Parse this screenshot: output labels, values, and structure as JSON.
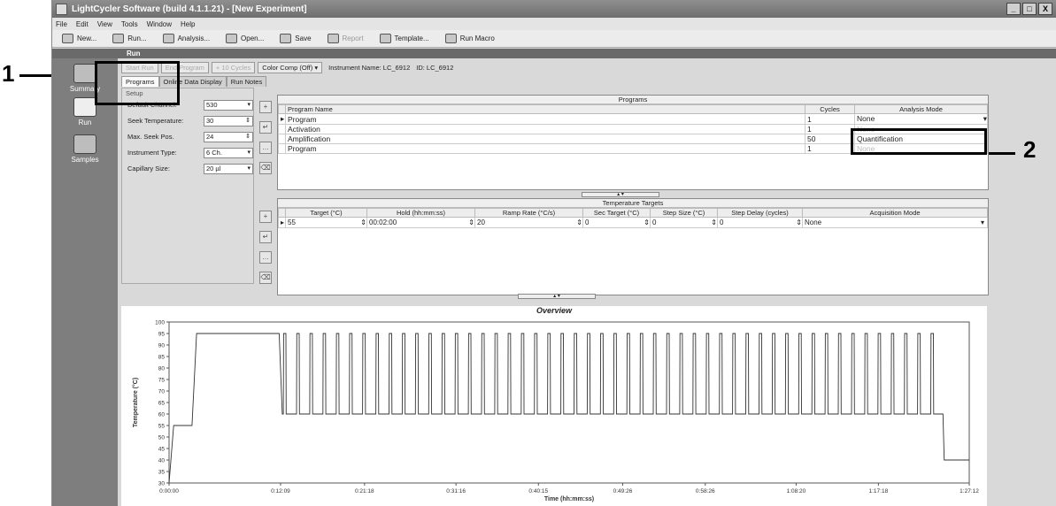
{
  "window": {
    "title": "LightCycler Software (build 4.1.1.21) - [New Experiment]",
    "controls": [
      "_",
      "□",
      "X"
    ]
  },
  "menu": [
    "File",
    "Edit",
    "View",
    "Tools",
    "Window",
    "Help"
  ],
  "toolbar": {
    "new": "New...",
    "run": "Run...",
    "analysis": "Analysis...",
    "open": "Open...",
    "save": "Save",
    "report": "Report",
    "template": "Template...",
    "run_macro": "Run Macro"
  },
  "run_bar": "Run",
  "nav": {
    "summary": "Summary",
    "run": "Run",
    "samples": "Samples"
  },
  "controls": {
    "start_run": "Start Run",
    "end_program": "End Program",
    "plus_cycles": "+ 10 Cycles",
    "color_comp": "Color Comp (Off)",
    "instrument_name": "Instrument Name: LC_6912",
    "instrument_id": "ID: LC_6912"
  },
  "tabs": [
    "Programs",
    "Online Data Display",
    "Run Notes"
  ],
  "setup": {
    "header": "Setup",
    "fields": [
      {
        "label": "Default Channel:",
        "value": "530"
      },
      {
        "label": "Seek Temperature:",
        "value": "30"
      },
      {
        "label": "Max. Seek Pos.",
        "value": "24"
      },
      {
        "label": "Instrument Type:",
        "value": "6 Ch."
      },
      {
        "label": "Capillary Size:",
        "value": "20 µl"
      }
    ]
  },
  "programs": {
    "title": "Programs",
    "columns": [
      "Program Name",
      "Cycles",
      "Analysis Mode"
    ],
    "rows": [
      {
        "name": "Program",
        "cycles": "1",
        "mode": "None"
      },
      {
        "name": "Activation",
        "cycles": "1",
        "mode": "None"
      },
      {
        "name": "Amplification",
        "cycles": "50",
        "mode": "Quantification"
      },
      {
        "name": "Program",
        "cycles": "1",
        "mode": "None"
      }
    ]
  },
  "temperature_targets": {
    "title": "Temperature Targets",
    "columns": [
      "Target (°C)",
      "Hold (hh:mm:ss)",
      "Ramp Rate (°C/s)",
      "Sec Target (°C)",
      "Step Size (°C)",
      "Step Delay (cycles)",
      "Acquisition Mode"
    ],
    "rows": [
      {
        "target": "55",
        "hold": "00:02:00",
        "ramp": "20",
        "sec_target": "0",
        "step_size": "0",
        "step_delay": "0",
        "acquisition": "None"
      }
    ]
  },
  "overview": {
    "title": "Overview"
  },
  "callouts": {
    "one": "1",
    "two": "2"
  },
  "chart_data": {
    "type": "line",
    "title": "Overview",
    "xlabel": "Time (hh:mm:ss)",
    "ylabel": "Temperature (°C)",
    "ylim": [
      30,
      100
    ],
    "yticks": [
      30,
      35,
      40,
      45,
      50,
      55,
      60,
      65,
      70,
      75,
      80,
      85,
      90,
      95,
      100
    ],
    "xticks": [
      "0:00:00",
      "0:12:09",
      "0:21:18",
      "0:31:16",
      "0:40:15",
      "0:49:26",
      "0:58:26",
      "1:08:20",
      "1:17:18",
      "1:27:12"
    ],
    "xtick_seconds": [
      0,
      729,
      1278,
      1876,
      2415,
      2966,
      3506,
      4100,
      4638,
      5232
    ],
    "series": [
      {
        "segments": [
          {
            "t": 0,
            "temp": 30
          },
          {
            "t": 30,
            "temp": 55
          },
          {
            "t": 150,
            "temp": 55
          },
          {
            "t": 180,
            "temp": 95
          },
          {
            "t": 720,
            "temp": 95
          },
          {
            "t": 740,
            "temp": 60
          }
        ],
        "cycles": {
          "count": 50,
          "low": 60,
          "high": 95,
          "start": 740,
          "end": 5060
        },
        "final_hold": {
          "t": 5060,
          "temp": 40,
          "end": 5232
        }
      }
    ],
    "grid": false
  }
}
